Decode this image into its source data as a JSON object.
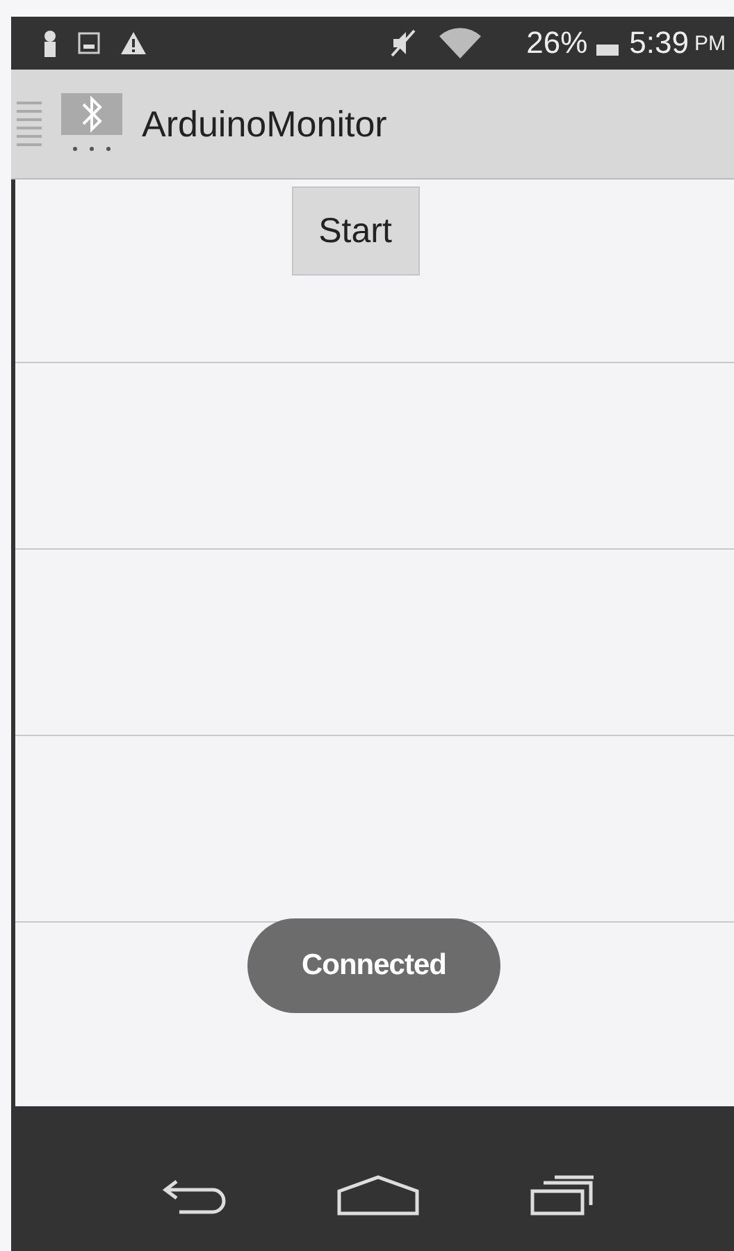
{
  "status_bar": {
    "battery": "26%",
    "time": "5:39",
    "period": "PM"
  },
  "action_bar": {
    "title": "ArduinoMonitor"
  },
  "start_button": {
    "label": "Start"
  },
  "toast": {
    "text": "Connected"
  }
}
